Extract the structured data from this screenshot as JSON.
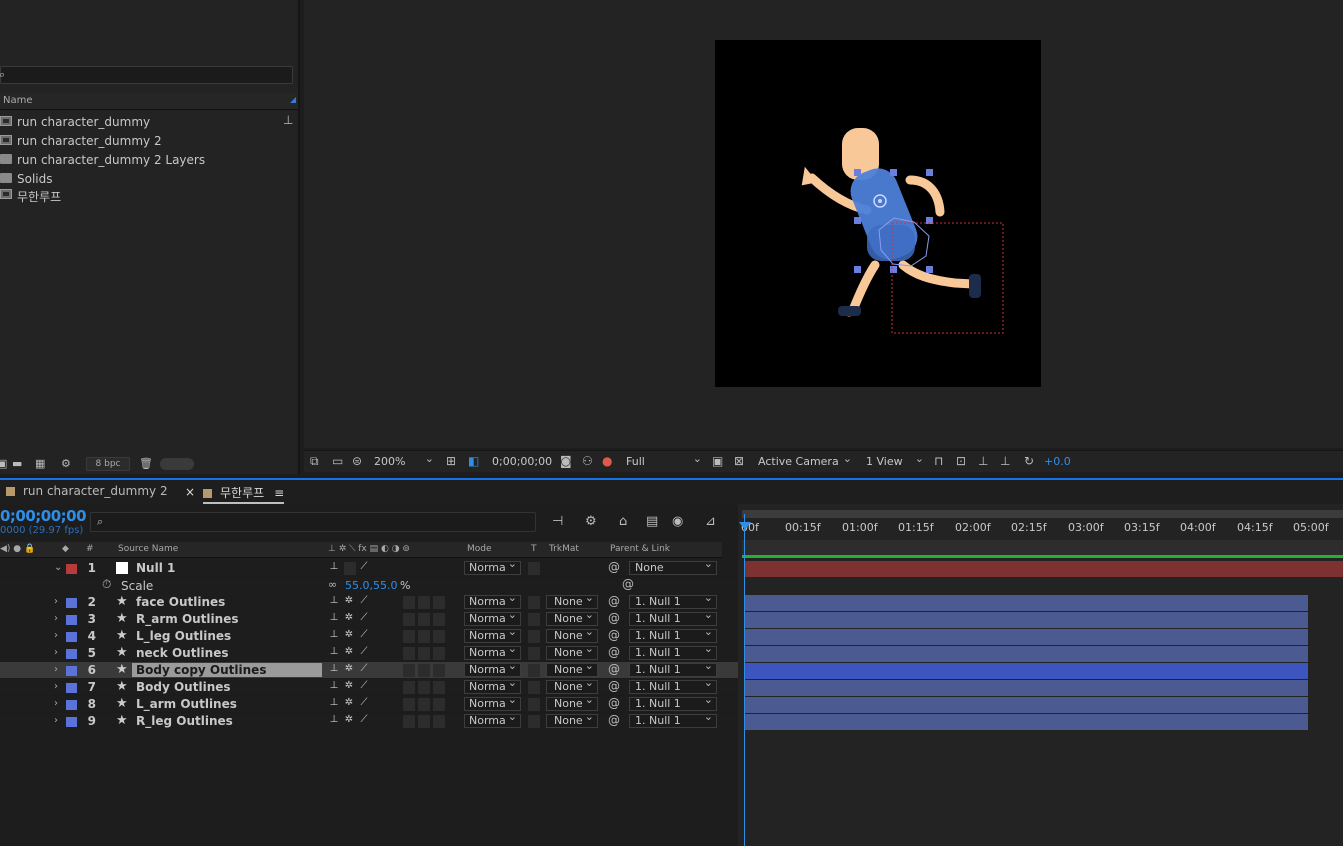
{
  "project": {
    "items": [
      {
        "label": "run character_dummy",
        "icon": "comp-icon"
      },
      {
        "label": "run character_dummy 2",
        "icon": "comp-icon"
      },
      {
        "label": "run character_dummy 2 Layers",
        "icon": "folder-icon"
      },
      {
        "label": "Solids",
        "icon": "folder-icon"
      },
      {
        "label": "무한루프",
        "icon": "comp-icon"
      }
    ],
    "name_header": "Name",
    "bpc": "8 bpc"
  },
  "viewer": {
    "zoom": "200%",
    "timecode": "0;00;00;00",
    "resolution": "Full",
    "camera": "Active Camera",
    "views": "1 View",
    "exposure": "+0.0"
  },
  "timeline": {
    "tabs": [
      "run character_dummy 2",
      "무한루프"
    ],
    "current_time": "0;00;00;00",
    "fps": "0000 (29.97 fps)",
    "columns": {
      "source_name": "Source Name",
      "mode": "Mode",
      "t": "T",
      "trkmat": "TrkMat",
      "parent": "Parent & Link"
    },
    "ruler": [
      "00f",
      "00:15f",
      "01:00f",
      "01:15f",
      "02:00f",
      "02:15f",
      "03:00f",
      "03:15f",
      "04:00f",
      "04:15f",
      "05:00f"
    ],
    "property": {
      "name": "Scale",
      "value": "55.0,55.0",
      "unit": "%"
    },
    "layers": [
      {
        "num": "1",
        "name": "Null 1",
        "color": "#b83b3b",
        "mode": "Norma",
        "trkmat": "",
        "parent": "None"
      },
      {
        "num": "2",
        "name": "face Outlines",
        "color": "#5b73d8",
        "mode": "Norma",
        "trkmat": "None",
        "parent": "1. Null 1"
      },
      {
        "num": "3",
        "name": "R_arm Outlines",
        "color": "#5b73d8",
        "mode": "Norma",
        "trkmat": "None",
        "parent": "1. Null 1"
      },
      {
        "num": "4",
        "name": "L_leg Outlines",
        "color": "#5b73d8",
        "mode": "Norma",
        "trkmat": "None",
        "parent": "1. Null 1"
      },
      {
        "num": "5",
        "name": "neck Outlines",
        "color": "#5b73d8",
        "mode": "Norma",
        "trkmat": "None",
        "parent": "1. Null 1"
      },
      {
        "num": "6",
        "name": "Body copy Outlines",
        "color": "#5b73d8",
        "mode": "Norma",
        "trkmat": "None",
        "parent": "1. Null 1"
      },
      {
        "num": "7",
        "name": "Body Outlines",
        "color": "#5b73d8",
        "mode": "Norma",
        "trkmat": "None",
        "parent": "1. Null 1"
      },
      {
        "num": "8",
        "name": "L_arm Outlines",
        "color": "#5b73d8",
        "mode": "Norma",
        "trkmat": "None",
        "parent": "1. Null 1"
      },
      {
        "num": "9",
        "name": "R_leg Outlines",
        "color": "#5b73d8",
        "mode": "Norma",
        "trkmat": "None",
        "parent": "1. Null 1"
      }
    ]
  }
}
